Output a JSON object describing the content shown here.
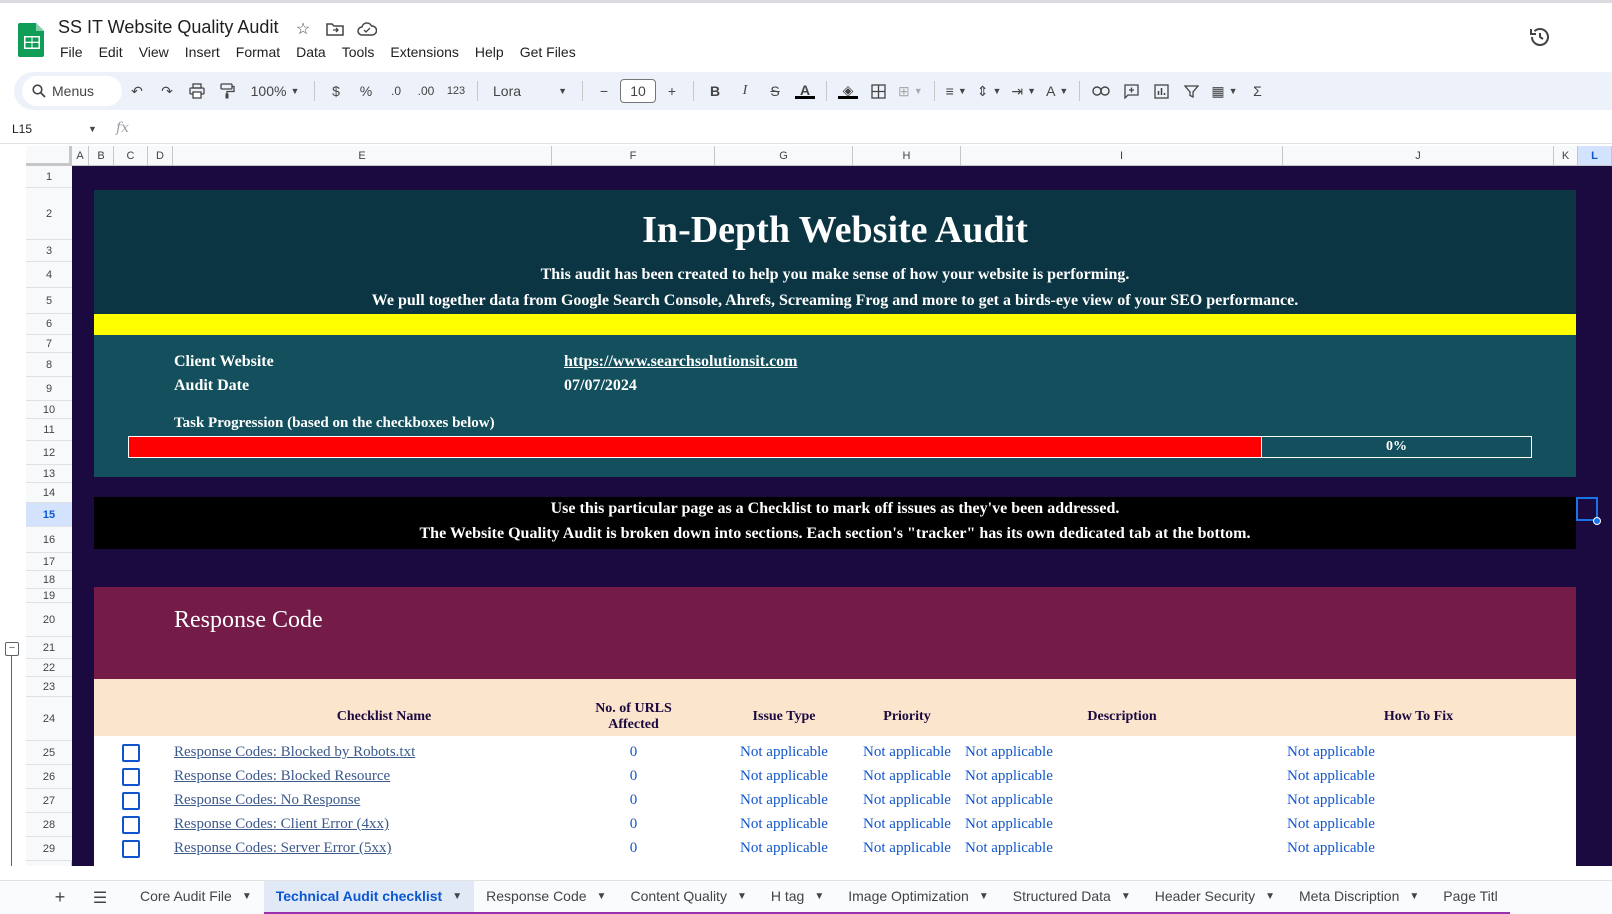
{
  "app": {
    "doc_title": "SS IT Website Quality Audit",
    "menus": [
      "File",
      "Edit",
      "View",
      "Insert",
      "Format",
      "Data",
      "Tools",
      "Extensions",
      "Help",
      "Get Files"
    ]
  },
  "toolbar": {
    "search_label": "Menus",
    "zoom": "100%",
    "currency": "$",
    "percent": "%",
    "decrease_decimal": ".0",
    "increase_decimal": ".00",
    "number_format": "123",
    "font": "Lora",
    "font_size": "10"
  },
  "formula_bar": {
    "name_box": "L15",
    "fx": "fx"
  },
  "columns": [
    {
      "label": "A"
    },
    {
      "label": "B"
    },
    {
      "label": "C"
    },
    {
      "label": "D"
    },
    {
      "label": "E"
    },
    {
      "label": "F"
    },
    {
      "label": "G"
    },
    {
      "label": "H"
    },
    {
      "label": "I"
    },
    {
      "label": "J"
    },
    {
      "label": "K"
    },
    {
      "label": "L"
    }
  ],
  "selected_column": "L",
  "selected_row": "15",
  "rows": [
    "1",
    "2",
    "3",
    "4",
    "5",
    "6",
    "7",
    "8",
    "9",
    "10",
    "11",
    "12",
    "13",
    "14",
    "15",
    "16",
    "17",
    "18",
    "19",
    "20",
    "21",
    "22",
    "23",
    "24",
    "25",
    "26",
    "27",
    "28",
    "29"
  ],
  "hero": {
    "title": "In-Depth Website Audit",
    "subtitle_1": "This audit has been created to help you make sense of how your website is performing.",
    "subtitle_2": "We pull together data from Google Search Console, Ahrefs, Screaming Frog and more to get a birds-eye view of your SEO performance."
  },
  "info": {
    "client_label": "Client Website",
    "client_value": "https://www.searchsolutionsit.com",
    "date_label": "Audit Date",
    "date_value": "07/07/2024",
    "progress_label": "Task Progression (based on the checkboxes below)",
    "progress_text": "0%",
    "progress_fraction": 0
  },
  "notice": {
    "line_1": "Use this particular page as a Checklist to mark off issues as they've been addressed.",
    "line_2": "The Website Quality Audit is broken down into sections. Each section's \"tracker\" has its own dedicated tab at the bottom."
  },
  "section": {
    "title": "Response Code",
    "headers": {
      "name": "Checklist Name",
      "urls_1": "No. of URLS",
      "urls_2": "Affected",
      "issue_type": "Issue Type",
      "priority": "Priority",
      "description": "Description",
      "how_to_fix": "How To Fix"
    },
    "items": [
      {
        "name": "Response Codes: Blocked by Robots.txt",
        "urls": "0",
        "issue_type": "Not applicable",
        "priority": "Not applicable",
        "description": "Not applicable",
        "how_to_fix": "Not applicable"
      },
      {
        "name": "Response Codes: Blocked Resource",
        "urls": "0",
        "issue_type": "Not applicable",
        "priority": "Not applicable",
        "description": "Not applicable",
        "how_to_fix": "Not applicable"
      },
      {
        "name": "Response Codes: No Response",
        "urls": "0",
        "issue_type": "Not applicable",
        "priority": "Not applicable",
        "description": "Not applicable",
        "how_to_fix": "Not applicable"
      },
      {
        "name": "Response Codes: Client Error (4xx)",
        "urls": "0",
        "issue_type": "Not applicable",
        "priority": "Not applicable",
        "description": "Not applicable",
        "how_to_fix": "Not applicable"
      },
      {
        "name": "Response Codes: Server Error (5xx)",
        "urls": "0",
        "issue_type": "Not applicable",
        "priority": "Not applicable",
        "description": "Not applicable",
        "how_to_fix": "Not applicable"
      }
    ]
  },
  "tabs": [
    {
      "label": "Core Audit File",
      "active": false
    },
    {
      "label": "Technical Audit checklist",
      "active": true
    },
    {
      "label": "Response Code",
      "active": false
    },
    {
      "label": "Content Quality",
      "active": false
    },
    {
      "label": "H tag",
      "active": false
    },
    {
      "label": "Image Optimization",
      "active": false
    },
    {
      "label": "Structured Data",
      "active": false
    },
    {
      "label": "Header Security",
      "active": false
    },
    {
      "label": "Meta Discription",
      "active": false
    },
    {
      "label": "Page Titl",
      "active": false
    }
  ],
  "colors": {
    "sheet_bg": "#1a0a40",
    "hero_bg": "#0b3542",
    "info_bg": "#134f5c",
    "accent_yellow": "#ffff00",
    "progress_red": "#ff0000",
    "section_bg": "#741b47",
    "table_head_bg": "#fce5cd",
    "link_blue": "#1155cc"
  }
}
